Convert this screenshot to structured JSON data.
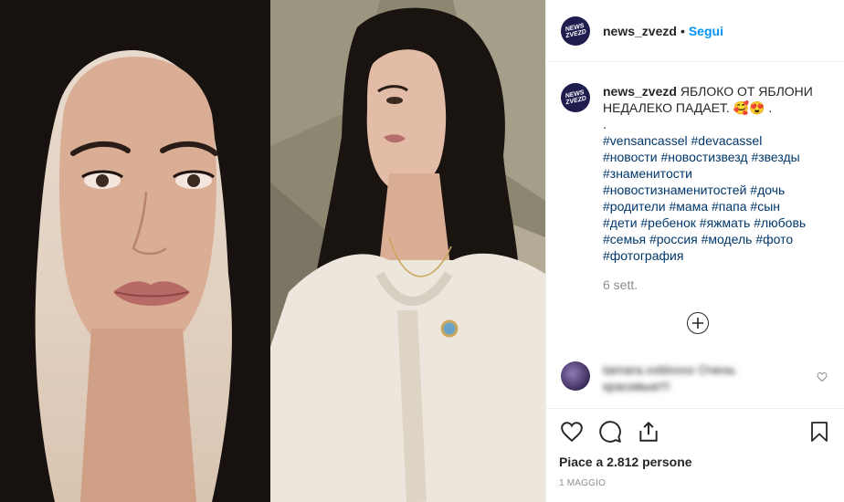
{
  "post": {
    "username": "news_zvezd",
    "avatar_text": "NEWS ZVEZD",
    "separator": "•",
    "follow_label": "Segui"
  },
  "caption": {
    "username": "news_zvezd",
    "text": "ЯБЛОКО ОТ ЯБЛОНИ НЕДАЛЕКО ПАДАЕТ. 🥰😍 .",
    "dot_line": ".",
    "hashtags": "#vensancassel #devacassel\n#новости #новостизвезд #звезды\n#знаменитости\n#новостизнаменитостей #дочь\n#родители #мама #папа #сын\n#дети #ребенок #яжмать #любовь\n#семья #россия #модель #фото\n#фотография",
    "time_ago": "6 sett."
  },
  "comment": {
    "text": "tamara.xxblxxxx Очень красивые!!!"
  },
  "actions": {
    "like_icon": "heart-icon",
    "comment_icon": "comment-icon",
    "share_icon": "share-icon",
    "save_icon": "bookmark-icon",
    "likes_text": "Piace a 2.812 persone",
    "date": "1 MAGGIO"
  },
  "colors": {
    "link_blue": "#0095f6",
    "hashtag": "#00376b",
    "muted": "#8e8e8e",
    "avatar_bg": "#1f1d4e"
  }
}
